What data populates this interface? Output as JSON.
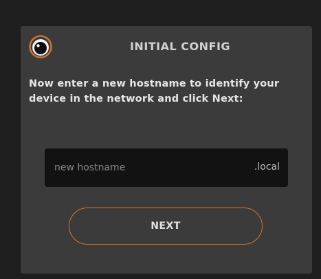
{
  "dialog": {
    "title": "INITIAL CONFIG",
    "instruction": "Now enter a new hostname to identify your device in the network and click Next:"
  },
  "hostname": {
    "value": "",
    "placeholder": "new hostname",
    "suffix": ".local"
  },
  "actions": {
    "next_label": "NEXT"
  },
  "icons": {
    "logo": "eye-logo-icon"
  },
  "colors": {
    "background": "#1e1e1e",
    "panel": "#3b3b3b",
    "input_background": "#121212",
    "accent": "#d4722b",
    "text": "#e6e6e6"
  }
}
